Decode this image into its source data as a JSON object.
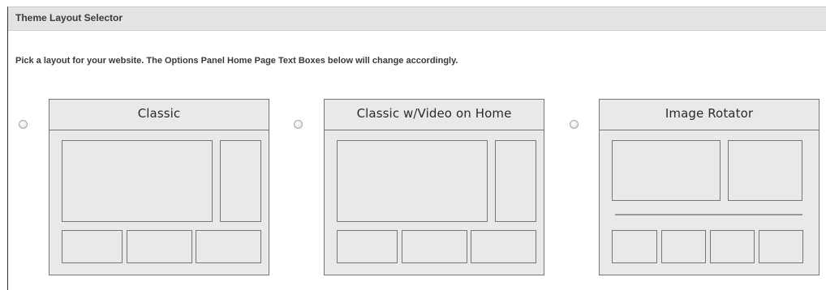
{
  "panel": {
    "title": "Theme Layout Selector",
    "instructions": "Pick a layout for your website. The Options Panel Home Page Text Boxes below will change accordingly."
  },
  "layouts": [
    {
      "title": "Classic",
      "selected": false
    },
    {
      "title": "Classic w/Video on Home",
      "selected": false
    },
    {
      "title": "Image Rotator",
      "selected": false
    }
  ],
  "colors": {
    "header_bg": "#e3e3e3",
    "card_bg": "#e9e9e9",
    "card_border": "#777777"
  }
}
